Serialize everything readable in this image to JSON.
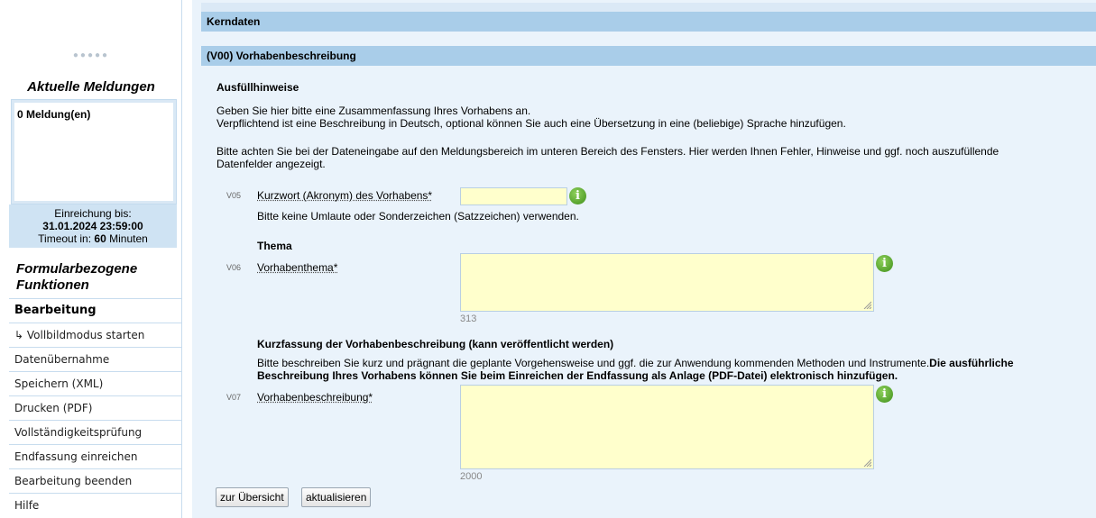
{
  "sidebar": {
    "logo_dots": "●●●●●",
    "messages_title": "Aktuelle Meldungen",
    "messages_count": "0 Meldung(en)",
    "deadline_label": "Einreichung bis:",
    "deadline_value": "31.01.2024 23:59:00",
    "timeout_prefix": "Timeout in:",
    "timeout_value": "60",
    "timeout_suffix": "Minuten",
    "functions_title": "Formularbezogene Funktionen",
    "menu": [
      "Bearbeitung",
      "↳ Vollbildmodus starten",
      "Datenübernahme",
      "Speichern (XML)",
      "Drucken (PDF)",
      "Vollständigkeitsprüfung",
      "Endfassung einreichen",
      "Bearbeitung beenden",
      "Hilfe"
    ]
  },
  "main": {
    "section_bar": "Kerndaten",
    "subsection_bar": "(V00) Vorhabenbeschreibung",
    "hints_title": "Ausfüllhinweise",
    "hint_line1": "Geben Sie hier bitte eine Zusammenfassung Ihres Vorhabens an.",
    "hint_line2": "Verpflichtend ist eine Beschreibung in Deutsch, optional können Sie auch eine Übersetzung in eine (beliebige) Sprache hinzufügen.",
    "hint_line3": "Bitte achten Sie bei der Dateneingabe auf den Meldungsbereich im unteren Bereich des Fensters. Hier werden Ihnen Fehler, Hinweise und ggf. noch auszufüllende",
    "hint_line4": "Datenfelder angezeigt.",
    "v05": {
      "code": "V05",
      "label": "Kurzwort (Akronym) des Vorhabens*",
      "value": "",
      "note": "Bitte keine Umlaute oder Sonderzeichen (Satzzeichen) verwenden."
    },
    "theme_title": "Thema",
    "v06": {
      "code": "V06",
      "label": "Vorhabenthema*",
      "value": "",
      "counter": "313"
    },
    "summary_title": "Kurzfassung der Vorhabenbeschreibung (kann veröffentlicht werden)",
    "summary_text_normal": "Bitte beschreiben Sie kurz und prägnant die geplante Vorgehensweise und ggf. die zur Anwendung kommenden Methoden und Instrumente.",
    "summary_text_bold1": "Die ausführliche",
    "summary_text_bold2": "Beschreibung Ihres Vorhabens können Sie beim Einreichen der Endfassung als Anlage (PDF-Datei) elektronisch hinzufügen.",
    "v07": {
      "code": "V07",
      "label": "Vorhabenbeschreibung*",
      "value": "",
      "counter": "2000"
    },
    "info_glyph": "i",
    "buttons": {
      "overview": "zur Übersicht",
      "refresh": "aktualisieren"
    }
  }
}
